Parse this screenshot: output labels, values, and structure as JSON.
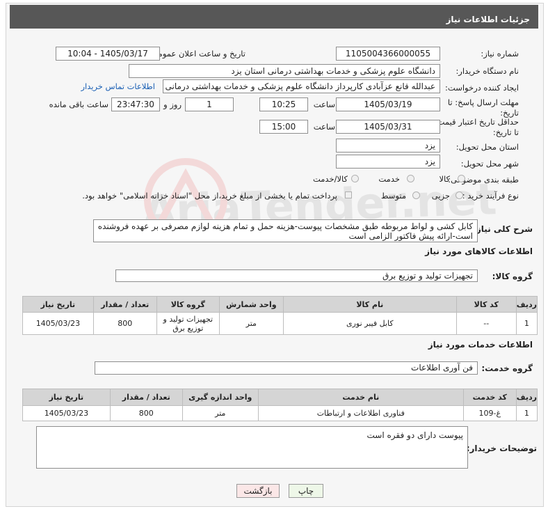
{
  "title": "جزئیات اطلاعات نیاز",
  "watermark": "AriaTender.net",
  "fields": {
    "need_number_label": "شماره نیاز:",
    "need_number": "1105004366000055",
    "announce_label": "تاریخ و ساعت اعلان عمومی:",
    "announce_value": "1405/03/17 - 10:04",
    "buyer_org_label": "نام دستگاه خریدار:",
    "buyer_org": "دانشگاه علوم پزشکی و خدمات بهداشتی  درمانی استان یزد",
    "creator_label": "ایجاد کننده درخواست:",
    "creator": "عبدالله قانع عزآبادی کارپرداز دانشگاه علوم پزشکی و خدمات بهداشتی  درمانی ا",
    "contact_link": "اطلاعات تماس خریدار",
    "deadline_label": "مهلت ارسال پاسخ: تا تاریخ:",
    "deadline_date": "1405/03/19",
    "time_label": "ساعت",
    "deadline_time": "10:25",
    "days": "1",
    "days_label": "روز و",
    "remaining_time": "23:47:30",
    "remaining_label": "ساعت باقی مانده",
    "min_validity_label": "حداقل تاریخ اعتبار قیمت: تا تاریخ:",
    "min_validity_date": "1405/03/31",
    "min_validity_time": "15:00",
    "province_label": "استان محل تحویل:",
    "province": "یزد",
    "city_label": "شهر محل تحویل:",
    "city": "یزد",
    "category_label": "طبقه بندی موضوعی:",
    "category_options": [
      "کالا",
      "خدمت",
      "کالا/خدمت"
    ],
    "process_label": "نوع فرآیند خرید :",
    "process_options": [
      "جزیی",
      "متوسط"
    ],
    "payment_note": "پرداخت تمام یا بخشی از مبلغ خرید،از محل \"اسناد خزانه اسلامی\" خواهد بود.",
    "description_label": "شرح کلی نیاز:",
    "description": "کابل کشی و لواط مربوطه طبق مشخصات پیوست-هزینه حمل و تمام هزینه لوازم مصرفی بر عهده فروشنده است-ارائه پیش فاکتور الزامی است"
  },
  "goods": {
    "section_title": "اطلاعات کالاهای مورد نیاز",
    "group_label": "گروه کالا:",
    "group_value": "تجهیزات تولید و توزیع برق",
    "headers": [
      "ردیف",
      "کد کالا",
      "نام کالا",
      "واحد شمارش",
      "گروه کالا",
      "تعداد / مقدار",
      "تاریخ نیاز"
    ],
    "rows": [
      [
        "1",
        "--",
        "کابل فیبر نوری",
        "متر",
        "تجهیزات تولید و توزیع برق",
        "800",
        "1405/03/23"
      ]
    ]
  },
  "services": {
    "section_title": "اطلاعات خدمات مورد نیاز",
    "group_label": "گروه خدمت:",
    "group_value": "فن آوری اطلاعات",
    "headers": [
      "ردیف",
      "کد خدمت",
      "نام خدمت",
      "واحد اندازه گیری",
      "تعداد / مقدار",
      "تاریخ نیاز"
    ],
    "rows": [
      [
        "1",
        "غ-109",
        "فناوری اطلاعات و ارتباطات",
        "متر",
        "800",
        "1405/03/23"
      ]
    ]
  },
  "buyer_notes": {
    "label": "توضیحات خریدار:",
    "value": "پیوست دارای دو فقره است"
  },
  "buttons": {
    "print": "چاپ",
    "back": "بازگشت"
  }
}
